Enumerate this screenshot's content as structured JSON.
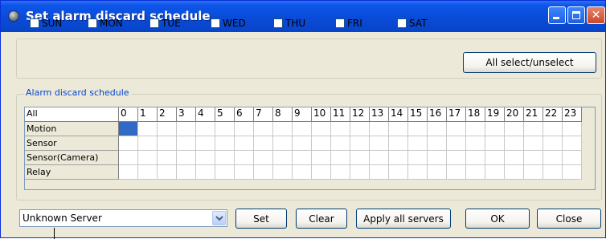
{
  "window": {
    "title": "Set alarm discard schedule"
  },
  "days": [
    {
      "label": "SUN",
      "checked": false
    },
    {
      "label": "MON",
      "checked": false
    },
    {
      "label": "TUE",
      "checked": false
    },
    {
      "label": "WED",
      "checked": false
    },
    {
      "label": "THU",
      "checked": false
    },
    {
      "label": "FRI",
      "checked": false
    },
    {
      "label": "SAT",
      "checked": false
    }
  ],
  "buttons": {
    "all_select": "All select/unselect",
    "set": "Set",
    "clear": "Clear",
    "apply_all": "Apply all servers",
    "ok": "OK",
    "close": "Close"
  },
  "schedule": {
    "group_label": "Alarm discard schedule",
    "corner_label": "All",
    "hours": [
      "0",
      "1",
      "2",
      "3",
      "4",
      "5",
      "6",
      "7",
      "8",
      "9",
      "10",
      "11",
      "12",
      "13",
      "14",
      "15",
      "16",
      "17",
      "18",
      "19",
      "20",
      "21",
      "22",
      "23"
    ],
    "rows": [
      "Motion",
      "Sensor",
      "Sensor(Camera)",
      "Relay"
    ],
    "selected_cells": [
      {
        "row": 0,
        "hour": 0
      }
    ]
  },
  "server": {
    "value": "Unknown Server"
  },
  "colors": {
    "titlebar": "#0a4ad6",
    "selection": "#316ac5",
    "group_label": "#0046d5"
  }
}
